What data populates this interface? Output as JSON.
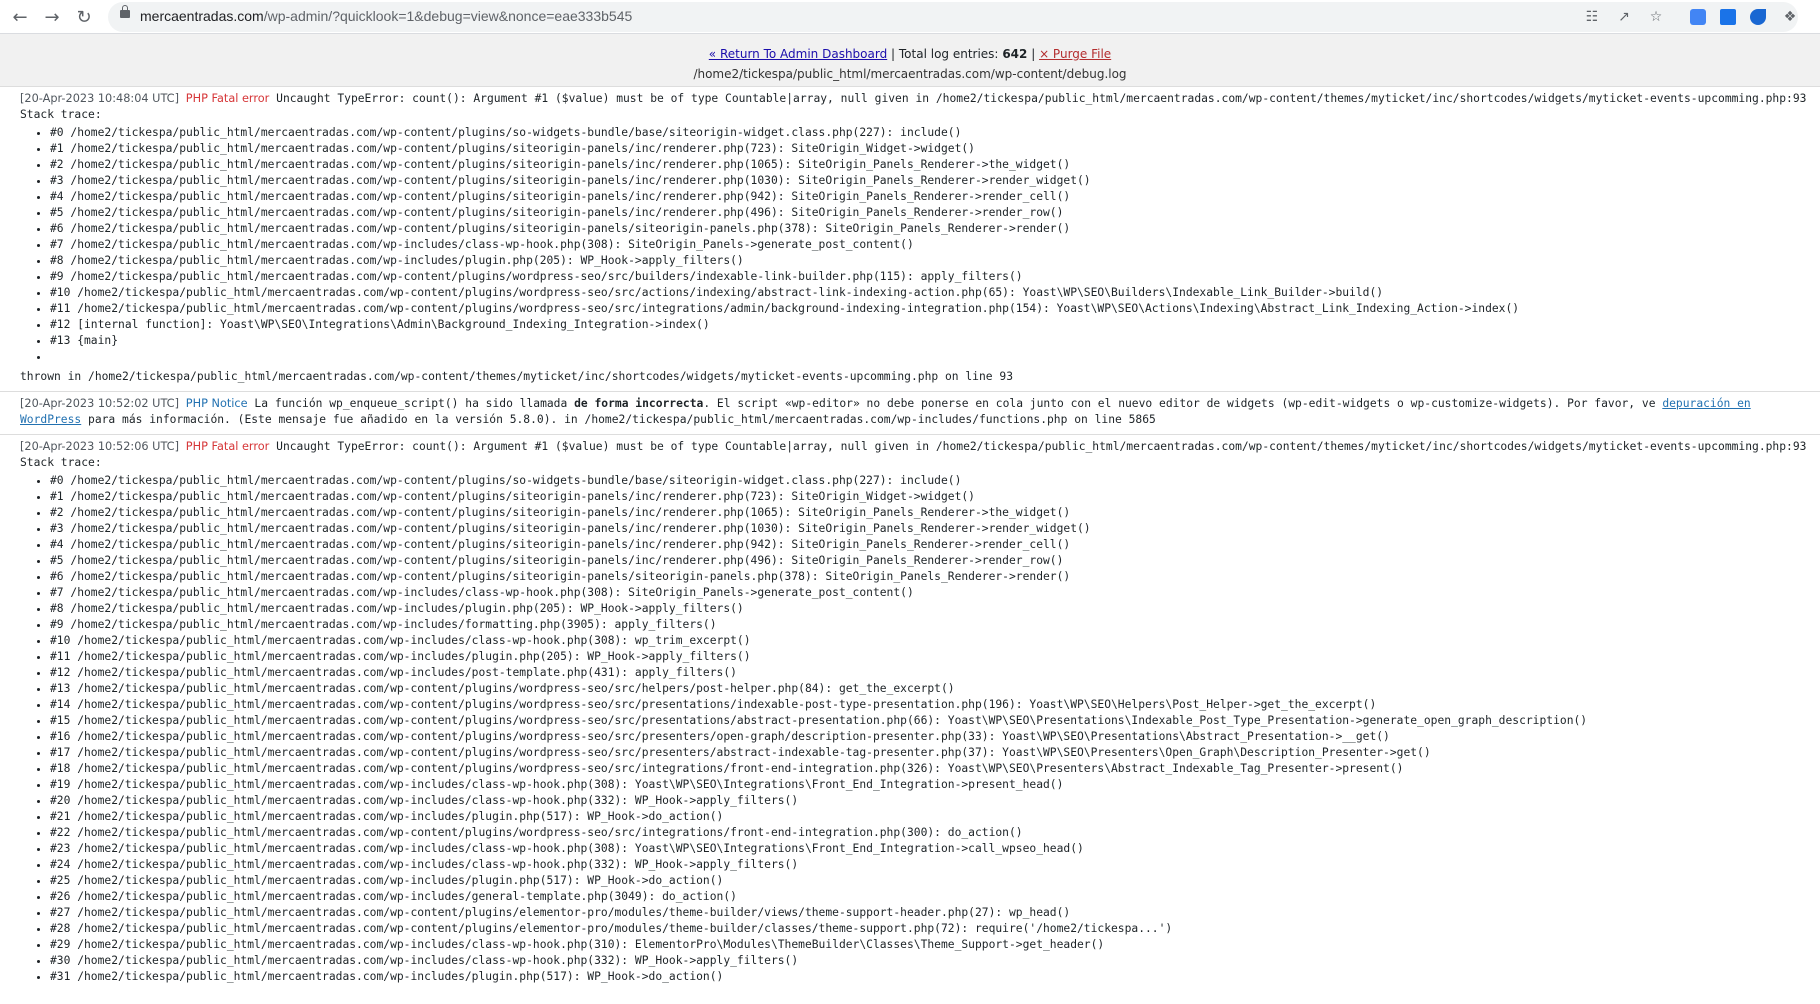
{
  "browser": {
    "url_host": "mercaentradas.com",
    "url_path": "/wp-admin/?quicklook=1&debug=view&nonce=eae333b545",
    "back_icon": "back-arrow-icon",
    "forward_icon": "forward-arrow-icon",
    "reload_icon": "reload-icon",
    "accent": "#1a73e8"
  },
  "header": {
    "return_link": "« Return To Admin Dashboard",
    "total_label": "Total log entries:",
    "total_count": "642",
    "purge_link": "× Purge File",
    "file_path": "/home2/tickespa/public_html/mercaentradas.com/wp-content/debug.log"
  },
  "entries": [
    {
      "timestamp": "[20-Apr-2023 10:48:04 UTC]",
      "level": "PHP Fatal error",
      "message": "Uncaught TypeError: count(): Argument #1 ($value) must be of type Countable|array, null given in /home2/tickespa/public_html/mercaentradas.com/wp-content/themes/myticket/inc/shortcodes/widgets/myticket-events-upcomming.php:93",
      "stack_label": "Stack trace:",
      "trace": [
        "#0 /home2/tickespa/public_html/mercaentradas.com/wp-content/plugins/so-widgets-bundle/base/siteorigin-widget.class.php(227): include()",
        "#1 /home2/tickespa/public_html/mercaentradas.com/wp-content/plugins/siteorigin-panels/inc/renderer.php(723): SiteOrigin_Widget->widget()",
        "#2 /home2/tickespa/public_html/mercaentradas.com/wp-content/plugins/siteorigin-panels/inc/renderer.php(1065): SiteOrigin_Panels_Renderer->the_widget()",
        "#3 /home2/tickespa/public_html/mercaentradas.com/wp-content/plugins/siteorigin-panels/inc/renderer.php(1030): SiteOrigin_Panels_Renderer->render_widget()",
        "#4 /home2/tickespa/public_html/mercaentradas.com/wp-content/plugins/siteorigin-panels/inc/renderer.php(942): SiteOrigin_Panels_Renderer->render_cell()",
        "#5 /home2/tickespa/public_html/mercaentradas.com/wp-content/plugins/siteorigin-panels/inc/renderer.php(496): SiteOrigin_Panels_Renderer->render_row()",
        "#6 /home2/tickespa/public_html/mercaentradas.com/wp-content/plugins/siteorigin-panels/siteorigin-panels.php(378): SiteOrigin_Panels_Renderer->render()",
        "#7 /home2/tickespa/public_html/mercaentradas.com/wp-includes/class-wp-hook.php(308): SiteOrigin_Panels->generate_post_content()",
        "#8 /home2/tickespa/public_html/mercaentradas.com/wp-includes/plugin.php(205): WP_Hook->apply_filters()",
        "#9 /home2/tickespa/public_html/mercaentradas.com/wp-content/plugins/wordpress-seo/src/builders/indexable-link-builder.php(115): apply_filters()",
        "#10 /home2/tickespa/public_html/mercaentradas.com/wp-content/plugins/wordpress-seo/src/actions/indexing/abstract-link-indexing-action.php(65): Yoast\\WP\\SEO\\Builders\\Indexable_Link_Builder->build()",
        "#11 /home2/tickespa/public_html/mercaentradas.com/wp-content/plugins/wordpress-seo/src/integrations/admin/background-indexing-integration.php(154): Yoast\\WP\\SEO\\Actions\\Indexing\\Abstract_Link_Indexing_Action->index()",
        "#12 [internal function]: Yoast\\WP\\SEO\\Integrations\\Admin\\Background_Indexing_Integration->index()",
        "#13 {main}",
        ""
      ],
      "thrown": "thrown in /home2/tickespa/public_html/mercaentradas.com/wp-content/themes/myticket/inc/shortcodes/widgets/myticket-events-upcomming.php on line 93"
    },
    {
      "timestamp": "[20-Apr-2023 10:52:02 UTC]",
      "level": "PHP Notice",
      "message_a": "La función wp_enqueue_script() ha sido llamada ",
      "message_bold": "de forma incorrecta",
      "message_b": ". El script «wp-editor» no debe ponerse en cola junto con el nuevo editor de widgets (wp-edit-widgets o wp-customize-widgets). Por favor, ve ",
      "link_text": "depuración en WordPress",
      "message_c": " para más información. (Este mensaje fue añadido en la versión 5.8.0). in /home2/tickespa/public_html/mercaentradas.com/wp-includes/functions.php on line 5865"
    },
    {
      "timestamp": "[20-Apr-2023 10:52:06 UTC]",
      "level": "PHP Fatal error",
      "message": "Uncaught TypeError: count(): Argument #1 ($value) must be of type Countable|array, null given in /home2/tickespa/public_html/mercaentradas.com/wp-content/themes/myticket/inc/shortcodes/widgets/myticket-events-upcomming.php:93",
      "stack_label": "Stack trace:",
      "trace": [
        "#0 /home2/tickespa/public_html/mercaentradas.com/wp-content/plugins/so-widgets-bundle/base/siteorigin-widget.class.php(227): include()",
        "#1 /home2/tickespa/public_html/mercaentradas.com/wp-content/plugins/siteorigin-panels/inc/renderer.php(723): SiteOrigin_Widget->widget()",
        "#2 /home2/tickespa/public_html/mercaentradas.com/wp-content/plugins/siteorigin-panels/inc/renderer.php(1065): SiteOrigin_Panels_Renderer->the_widget()",
        "#3 /home2/tickespa/public_html/mercaentradas.com/wp-content/plugins/siteorigin-panels/inc/renderer.php(1030): SiteOrigin_Panels_Renderer->render_widget()",
        "#4 /home2/tickespa/public_html/mercaentradas.com/wp-content/plugins/siteorigin-panels/inc/renderer.php(942): SiteOrigin_Panels_Renderer->render_cell()",
        "#5 /home2/tickespa/public_html/mercaentradas.com/wp-content/plugins/siteorigin-panels/inc/renderer.php(496): SiteOrigin_Panels_Renderer->render_row()",
        "#6 /home2/tickespa/public_html/mercaentradas.com/wp-content/plugins/siteorigin-panels/siteorigin-panels.php(378): SiteOrigin_Panels_Renderer->render()",
        "#7 /home2/tickespa/public_html/mercaentradas.com/wp-includes/class-wp-hook.php(308): SiteOrigin_Panels->generate_post_content()",
        "#8 /home2/tickespa/public_html/mercaentradas.com/wp-includes/plugin.php(205): WP_Hook->apply_filters()",
        "#9 /home2/tickespa/public_html/mercaentradas.com/wp-includes/formatting.php(3905): apply_filters()",
        "#10 /home2/tickespa/public_html/mercaentradas.com/wp-includes/class-wp-hook.php(308): wp_trim_excerpt()",
        "#11 /home2/tickespa/public_html/mercaentradas.com/wp-includes/plugin.php(205): WP_Hook->apply_filters()",
        "#12 /home2/tickespa/public_html/mercaentradas.com/wp-includes/post-template.php(431): apply_filters()",
        "#13 /home2/tickespa/public_html/mercaentradas.com/wp-content/plugins/wordpress-seo/src/helpers/post-helper.php(84): get_the_excerpt()",
        "#14 /home2/tickespa/public_html/mercaentradas.com/wp-content/plugins/wordpress-seo/src/presentations/indexable-post-type-presentation.php(196): Yoast\\WP\\SEO\\Helpers\\Post_Helper->get_the_excerpt()",
        "#15 /home2/tickespa/public_html/mercaentradas.com/wp-content/plugins/wordpress-seo/src/presentations/abstract-presentation.php(66): Yoast\\WP\\SEO\\Presentations\\Indexable_Post_Type_Presentation->generate_open_graph_description()",
        "#16 /home2/tickespa/public_html/mercaentradas.com/wp-content/plugins/wordpress-seo/src/presenters/open-graph/description-presenter.php(33): Yoast\\WP\\SEO\\Presentations\\Abstract_Presentation->__get()",
        "#17 /home2/tickespa/public_html/mercaentradas.com/wp-content/plugins/wordpress-seo/src/presenters/abstract-indexable-tag-presenter.php(37): Yoast\\WP\\SEO\\Presenters\\Open_Graph\\Description_Presenter->get()",
        "#18 /home2/tickespa/public_html/mercaentradas.com/wp-content/plugins/wordpress-seo/src/integrations/front-end-integration.php(326): Yoast\\WP\\SEO\\Presenters\\Abstract_Indexable_Tag_Presenter->present()",
        "#19 /home2/tickespa/public_html/mercaentradas.com/wp-includes/class-wp-hook.php(308): Yoast\\WP\\SEO\\Integrations\\Front_End_Integration->present_head()",
        "#20 /home2/tickespa/public_html/mercaentradas.com/wp-includes/class-wp-hook.php(332): WP_Hook->apply_filters()",
        "#21 /home2/tickespa/public_html/mercaentradas.com/wp-includes/plugin.php(517): WP_Hook->do_action()",
        "#22 /home2/tickespa/public_html/mercaentradas.com/wp-content/plugins/wordpress-seo/src/integrations/front-end-integration.php(300): do_action()",
        "#23 /home2/tickespa/public_html/mercaentradas.com/wp-includes/class-wp-hook.php(308): Yoast\\WP\\SEO\\Integrations\\Front_End_Integration->call_wpseo_head()",
        "#24 /home2/tickespa/public_html/mercaentradas.com/wp-includes/class-wp-hook.php(332): WP_Hook->apply_filters()",
        "#25 /home2/tickespa/public_html/mercaentradas.com/wp-includes/plugin.php(517): WP_Hook->do_action()",
        "#26 /home2/tickespa/public_html/mercaentradas.com/wp-includes/general-template.php(3049): do_action()",
        "#27 /home2/tickespa/public_html/mercaentradas.com/wp-content/plugins/elementor-pro/modules/theme-builder/views/theme-support-header.php(27): wp_head()",
        "#28 /home2/tickespa/public_html/mercaentradas.com/wp-content/plugins/elementor-pro/modules/theme-builder/classes/theme-support.php(72): require('/home2/tickespa...')",
        "#29 /home2/tickespa/public_html/mercaentradas.com/wp-includes/class-wp-hook.php(310): ElementorPro\\Modules\\ThemeBuilder\\Classes\\Theme_Support->get_header()",
        "#30 /home2/tickespa/public_html/mercaentradas.com/wp-includes/class-wp-hook.php(332): WP_Hook->apply_filters()",
        "#31 /home2/tickespa/public_html/mercaentradas.com/wp-includes/plugin.php(517): WP_Hook->do_action()"
      ]
    }
  ]
}
